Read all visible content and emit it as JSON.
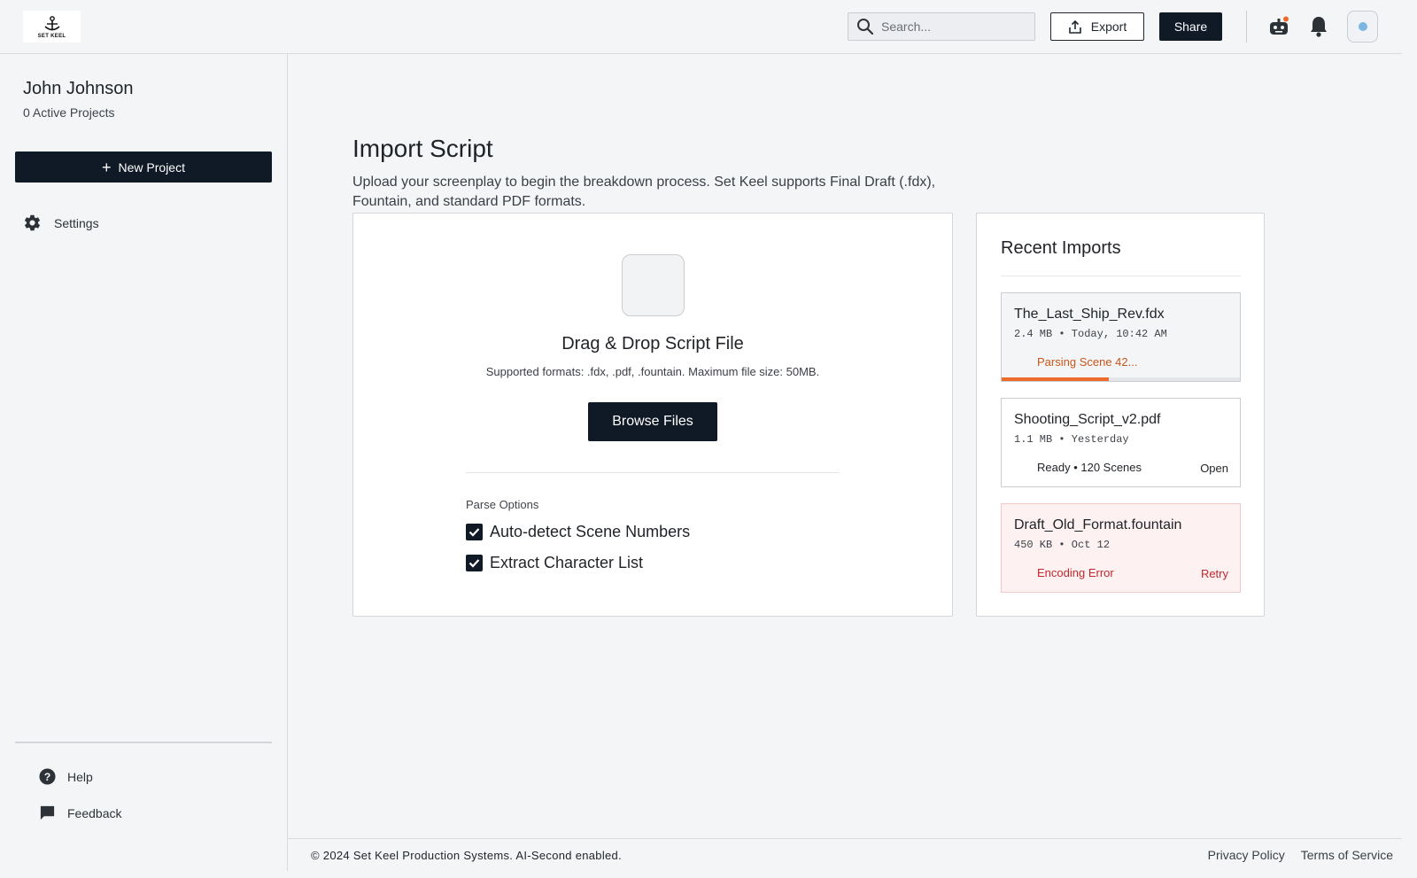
{
  "header": {
    "logo_text": "SET KEEL",
    "search_placeholder": "Search...",
    "export_label": "Export",
    "share_label": "Share"
  },
  "sidebar": {
    "user_name": "John Johnson",
    "active_projects": "0 Active Projects",
    "new_project_label": "New Project",
    "settings_label": "Settings",
    "help_label": "Help",
    "feedback_label": "Feedback"
  },
  "main": {
    "title": "Import Script",
    "description": "Upload your screenplay to begin the breakdown process. Set Keel supports Final Draft (.fdx), Fountain, and standard PDF formats.",
    "upload": {
      "title": "Drag & Drop Script File",
      "formats": "Supported formats: .fdx, .pdf, .fountain. Maximum file size: 50MB.",
      "browse_label": "Browse Files",
      "parse_options_label": "Parse Options",
      "options": [
        {
          "label": "Auto-detect Scene Numbers",
          "checked": true
        },
        {
          "label": "Extract Character List",
          "checked": true
        }
      ]
    },
    "recent": {
      "title": "Recent Imports",
      "items": [
        {
          "name": "The_Last_Ship_Rev.fdx",
          "meta": "2.4 MB • Today, 10:42 AM",
          "status": "Parsing Scene 42...",
          "action": "",
          "progress": 0.45
        },
        {
          "name": "Shooting_Script_v2.pdf",
          "meta": "1.1 MB • Yesterday",
          "status": "Ready • 120 Scenes",
          "action": "Open"
        },
        {
          "name": "Draft_Old_Format.fountain",
          "meta": "450 KB • Oct 12",
          "status": "Encoding Error",
          "action": "Retry"
        }
      ]
    }
  },
  "footer": {
    "copyright": "© 2024 Set Keel Production Systems. AI-Second enabled.",
    "privacy_label": "Privacy Policy",
    "terms_label": "Terms of Service"
  },
  "colors": {
    "primary": "#0f1a26",
    "progress": "#ee6a2a",
    "error": "#c2272d",
    "notification_dot": "#ee6a2a"
  }
}
